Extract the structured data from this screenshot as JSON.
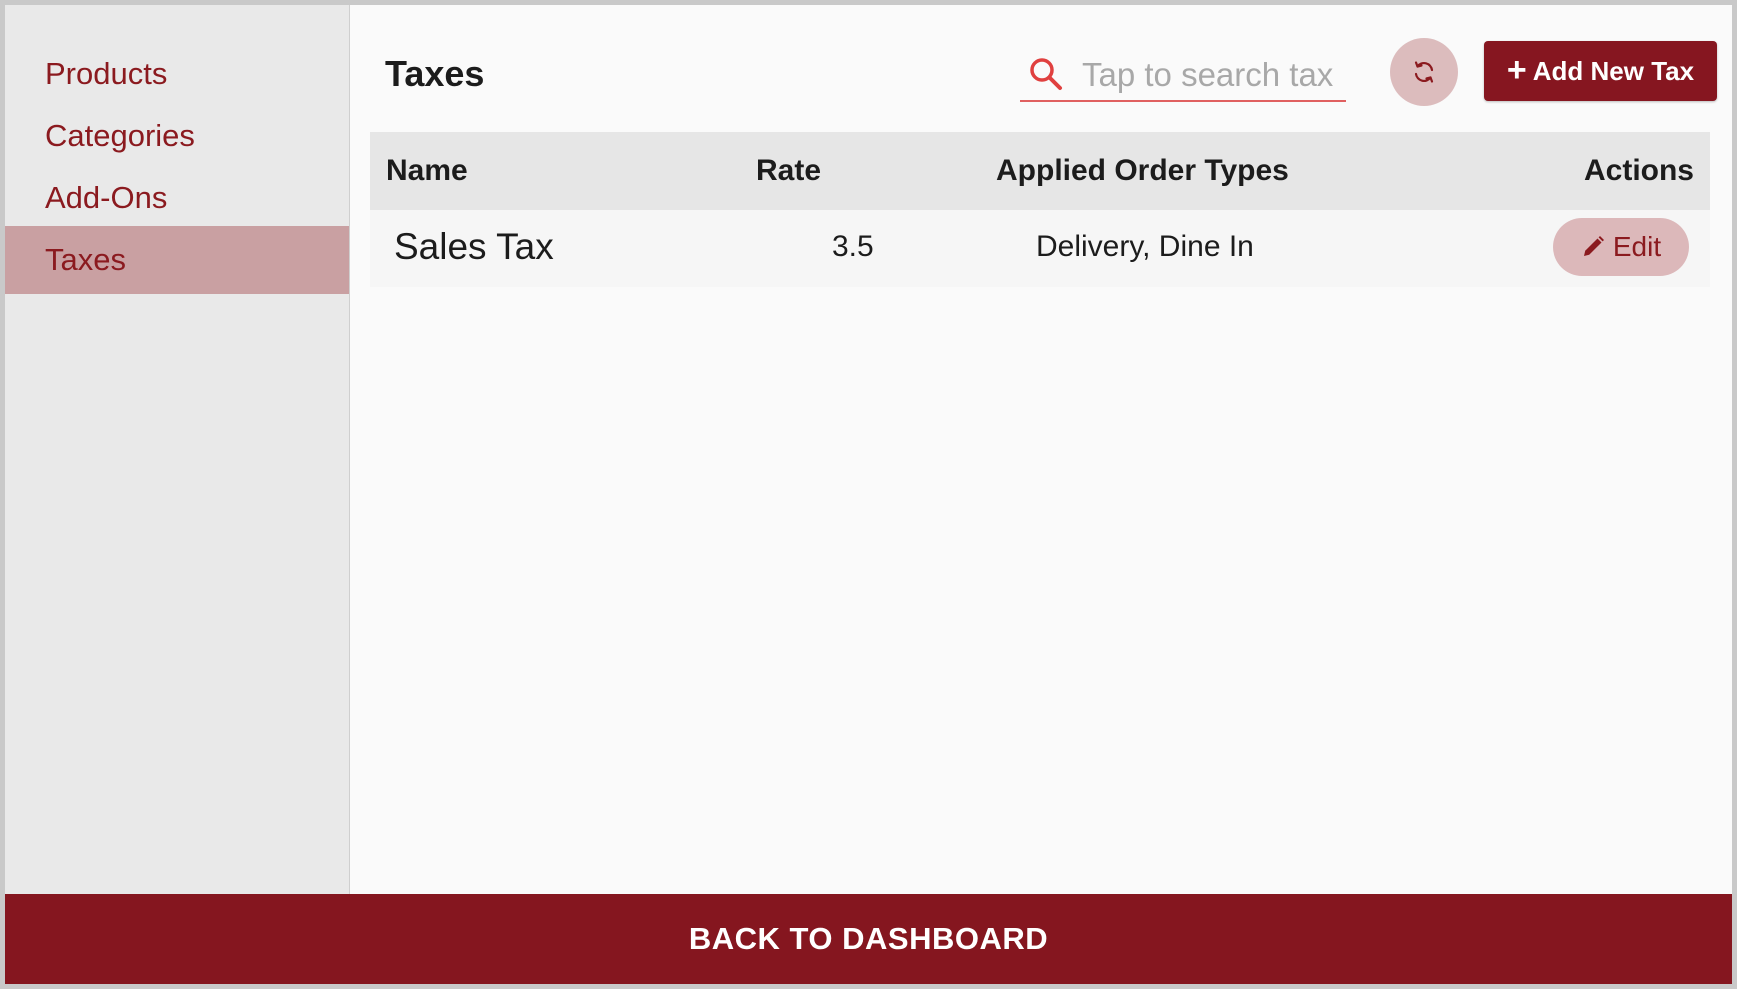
{
  "sidebar": {
    "items": [
      {
        "label": "Products"
      },
      {
        "label": "Categories"
      },
      {
        "label": "Add-Ons"
      },
      {
        "label": "Taxes",
        "active": true
      }
    ]
  },
  "header": {
    "title": "Taxes",
    "search": {
      "placeholder": "Tap to search tax",
      "value": "",
      "icon": "search-icon"
    },
    "refresh_icon": "refresh-icon",
    "add_button": {
      "label": "Add New Tax",
      "icon": "plus-icon"
    }
  },
  "table": {
    "columns": [
      "Name",
      "Rate",
      "Applied Order Types",
      "Actions"
    ],
    "rows": [
      {
        "name": "Sales Tax",
        "rate": "3.5",
        "order_types": "Delivery, Dine In",
        "action": {
          "label": "Edit",
          "icon": "pencil-icon"
        }
      }
    ]
  },
  "footer": {
    "label": "BACK TO DASHBOARD"
  },
  "colors": {
    "brand": "#85161f",
    "sidebar_active": "#c9a0a2",
    "sidebar_bg": "#e9e9e9",
    "edit_button": "#dcb8ba",
    "refresh_button": "#dcbcbd",
    "search_underline": "#e06060"
  }
}
